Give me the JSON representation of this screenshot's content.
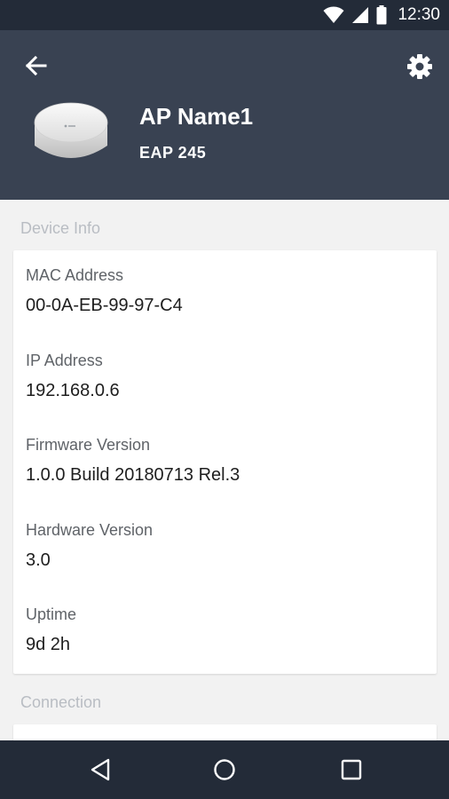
{
  "status_bar": {
    "time": "12:30",
    "icons": [
      "wifi-icon",
      "signal-icon",
      "battery-icon"
    ]
  },
  "header": {
    "back_icon": "arrow-back-icon",
    "settings_icon": "gear-icon",
    "device_name": "AP Name1",
    "device_model": "EAP 245"
  },
  "device_info": {
    "section_title": "Device Info",
    "fields": [
      {
        "label": "MAC Address",
        "value": "00-0A-EB-99-97-C4"
      },
      {
        "label": "IP Address",
        "value": "192.168.0.6"
      },
      {
        "label": "Firmware Version",
        "value": "1.0.0 Build 20180713 Rel.3"
      },
      {
        "label": "Hardware Version",
        "value": "3.0"
      },
      {
        "label": "Uptime",
        "value": "9d 2h"
      }
    ]
  },
  "connection": {
    "section_title": "Connection"
  },
  "nav_bar": {
    "icons": [
      "nav-back-icon",
      "nav-home-icon",
      "nav-recents-icon"
    ]
  },
  "colors": {
    "header_bg": "#394252",
    "status_bg": "#232b38",
    "page_bg": "#f2f2f2",
    "section_label": "#b9bdc3"
  }
}
